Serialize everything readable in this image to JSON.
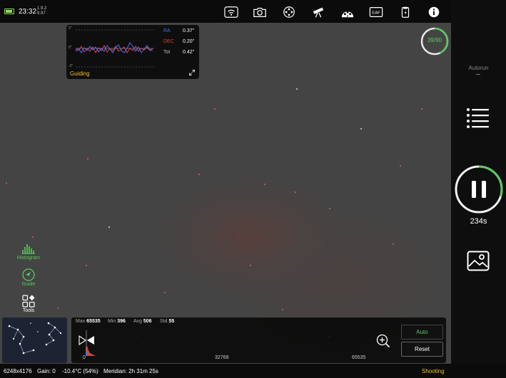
{
  "status": {
    "time": "23:32",
    "version_line1": "1.9.2",
    "version_line2": "9.97",
    "battery_color": "#8fe05c"
  },
  "toolbar": {
    "icons": [
      "wifi-icon",
      "camera-icon",
      "mount-icon",
      "telescope-icon",
      "filter-wheel-icon",
      "eaf-icon",
      "storage-icon",
      "info-icon"
    ],
    "filter_badge": "6",
    "eaf_label": "EAF"
  },
  "guiding": {
    "title": "Guiding",
    "axis_top": "2\"",
    "axis_mid": "0\"",
    "axis_bottom": "-2\"",
    "ra_label": "RA",
    "ra_value": "0.37\"",
    "dec_label": "DEC",
    "dec_value": "0.20\"",
    "tot_label": "Tot",
    "tot_value": "0.42\"",
    "ra_color": "#4a6cff",
    "dec_color": "#e0403a"
  },
  "tools": {
    "histogram_label": "Histogram",
    "guide_label": "Guide",
    "tools_label": "Tools",
    "accent_color": "#5ec75e"
  },
  "histogram": {
    "max_label": "Max",
    "max_value": "65535",
    "min_label": "Min",
    "min_value": "396",
    "avg_label": "Avg",
    "avg_value": "506",
    "std_label": "Std",
    "std_value": "55",
    "axis_start": "0",
    "axis_mid": "32768",
    "axis_end": "65535",
    "auto_button": "Auto",
    "reset_button": "Reset"
  },
  "capture": {
    "counter": "39/90",
    "progress_fraction": 0.433,
    "autorun_label": "Autorun",
    "exposure_remaining": "234s",
    "exposure_progress_fraction": 0.3
  },
  "bottom": {
    "resolution": "6248x4176",
    "gain": "Gain: 0",
    "temperature": "-10.4°C (54%)",
    "meridian": "Meridian: 2h 31m 25s",
    "state": "Shooting"
  }
}
